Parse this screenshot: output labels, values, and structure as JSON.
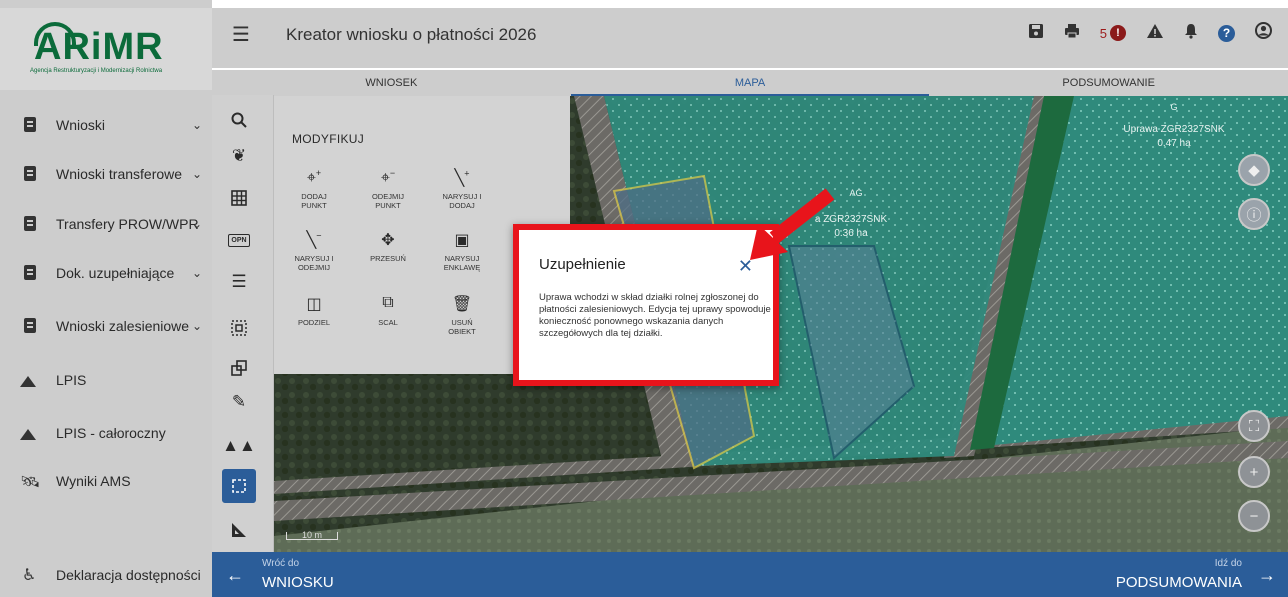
{
  "logo": {
    "name": "ARiMR",
    "subtitle": "Agencja Restrukturyzacji i Modernizacji Rolnictwa"
  },
  "header": {
    "title": "Kreator wniosku o płatności 2026",
    "error_count": "5"
  },
  "tabs": [
    {
      "label": "WNIOSEK"
    },
    {
      "label": "MAPA"
    },
    {
      "label": "PODSUMOWANIE"
    }
  ],
  "sidebar": {
    "items": [
      {
        "label": "Wnioski",
        "icon": "clipboard-icon",
        "expandable": true
      },
      {
        "label": "Wnioski transferowe",
        "icon": "clipboard-icon",
        "expandable": true
      },
      {
        "label": "Transfery PROW/WPR",
        "icon": "clipboard-icon",
        "expandable": true
      },
      {
        "label": "Dok. uzupełniające",
        "icon": "clipboard-icon",
        "expandable": true
      },
      {
        "label": "Wnioski zalesieniowe",
        "icon": "clipboard-icon",
        "expandable": true
      },
      {
        "label": "LPIS",
        "icon": "mountain-icon",
        "expandable": false
      },
      {
        "label": "LPIS - całoroczny",
        "icon": "mountain-icon",
        "expandable": false
      },
      {
        "label": "Wyniki AMS",
        "icon": "satellite-icon",
        "expandable": false
      }
    ],
    "footer": {
      "label": "Deklaracja dostępności",
      "icon": "accessibility-icon"
    }
  },
  "tools": [
    {
      "icon": "search-icon"
    },
    {
      "icon": "plant-icon"
    },
    {
      "icon": "grid-icon"
    },
    {
      "icon": "opn-icon",
      "label": "OPN"
    },
    {
      "icon": "list-icon"
    },
    {
      "icon": "selection-icon"
    },
    {
      "icon": "layers-copy-icon"
    },
    {
      "icon": "pencil-icon"
    },
    {
      "icon": "forest-icon"
    },
    {
      "icon": "modify-icon",
      "active": true
    },
    {
      "icon": "measure-icon"
    }
  ],
  "modify": {
    "title": "MODYFIKUJ",
    "buttons": [
      {
        "label": "DODAJ\nPUNKT",
        "icon": "add-point-icon"
      },
      {
        "label": "ODEJMIJ\nPUNKT",
        "icon": "remove-point-icon"
      },
      {
        "label": "NARYSUJ I\nDODAJ",
        "icon": "draw-add-icon"
      },
      {
        "label": "NARYSUJ I\nODEJMIJ",
        "icon": "draw-subtract-icon"
      },
      {
        "label": "PRZESUŃ",
        "icon": "move-icon"
      },
      {
        "label": "NARYSUJ\nENKLAWĘ",
        "icon": "enclave-icon"
      },
      {
        "label": "PODZIEL",
        "icon": "split-icon"
      },
      {
        "label": "SCAL",
        "icon": "merge-icon"
      },
      {
        "label": "USUŃ\nOBIEKT",
        "icon": "delete-icon"
      }
    ]
  },
  "map": {
    "labels": [
      {
        "code": "G",
        "crop": "Uprawa ZGR2327SNK",
        "area": "0.47 ha"
      },
      {
        "code": "AG",
        "crop": "a ZGR2327SNK",
        "area": "0.36 ha"
      }
    ],
    "scale": "10 m",
    "colors": {
      "parcel_fill": "#2f8a7c",
      "parcel_border": "#d8c84a",
      "accent": "#2b5d99"
    }
  },
  "dialog": {
    "title": "Uzupełnienie",
    "body": "Uprawa wchodzi w skład działki rolnej zgłoszonej do płatności zalesieniowych. Edycja tej uprawy spowoduje konieczność ponownego wskazania danych szczegółowych dla tej działki.",
    "highlight_color": "#e8141b"
  },
  "footer": {
    "back_small": "Wróć do",
    "back_big": "WNIOSKU",
    "next_small": "Idź do",
    "next_big": "PODSUMOWANIA"
  }
}
